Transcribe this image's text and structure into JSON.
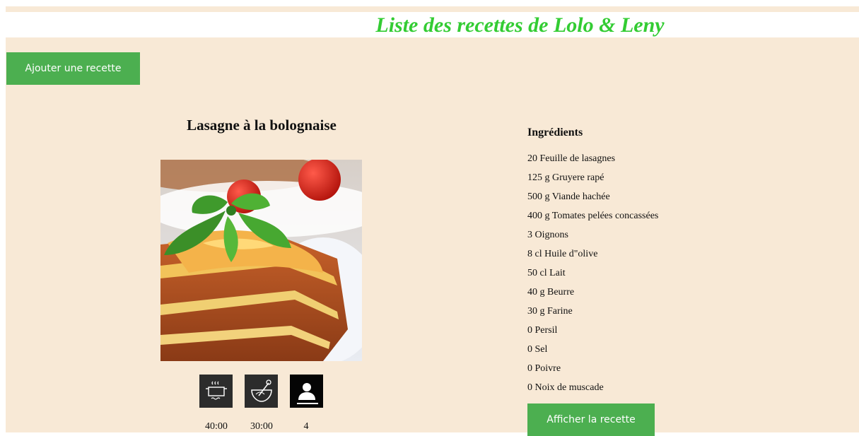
{
  "header": {
    "title": "Liste des recettes de Lolo & Leny",
    "title_color": "#33cc33",
    "background_color": "#f8e9d6"
  },
  "actions": {
    "add_recipe_label": "Ajouter une recette",
    "show_recipe_label": "Afficher la recette",
    "button_color": "#4caf50"
  },
  "recipe": {
    "title": "Lasagne à la bolognaise",
    "image_subject": "lasagna-with-basil-and-tomatoes",
    "stats": [
      {
        "icon": "cooking-pot-icon",
        "value": "40:00"
      },
      {
        "icon": "mixing-bowl-whisk-icon",
        "value": "30:00"
      },
      {
        "icon": "person-icon",
        "value": "4"
      }
    ],
    "ingredients_heading": "Ingrédients",
    "ingredients": [
      "20 Feuille de lasagnes",
      "125 g Gruyere rapé",
      "500 g Viande hachée",
      "400 g Tomates pelées concassées",
      "3 Oignons",
      "8 cl Huile d\"olive",
      "50 cl Lait",
      "40 g Beurre",
      "30 g Farine",
      "0 Persil",
      "0 Sel",
      "0 Poivre",
      "0 Noix de muscade"
    ]
  }
}
